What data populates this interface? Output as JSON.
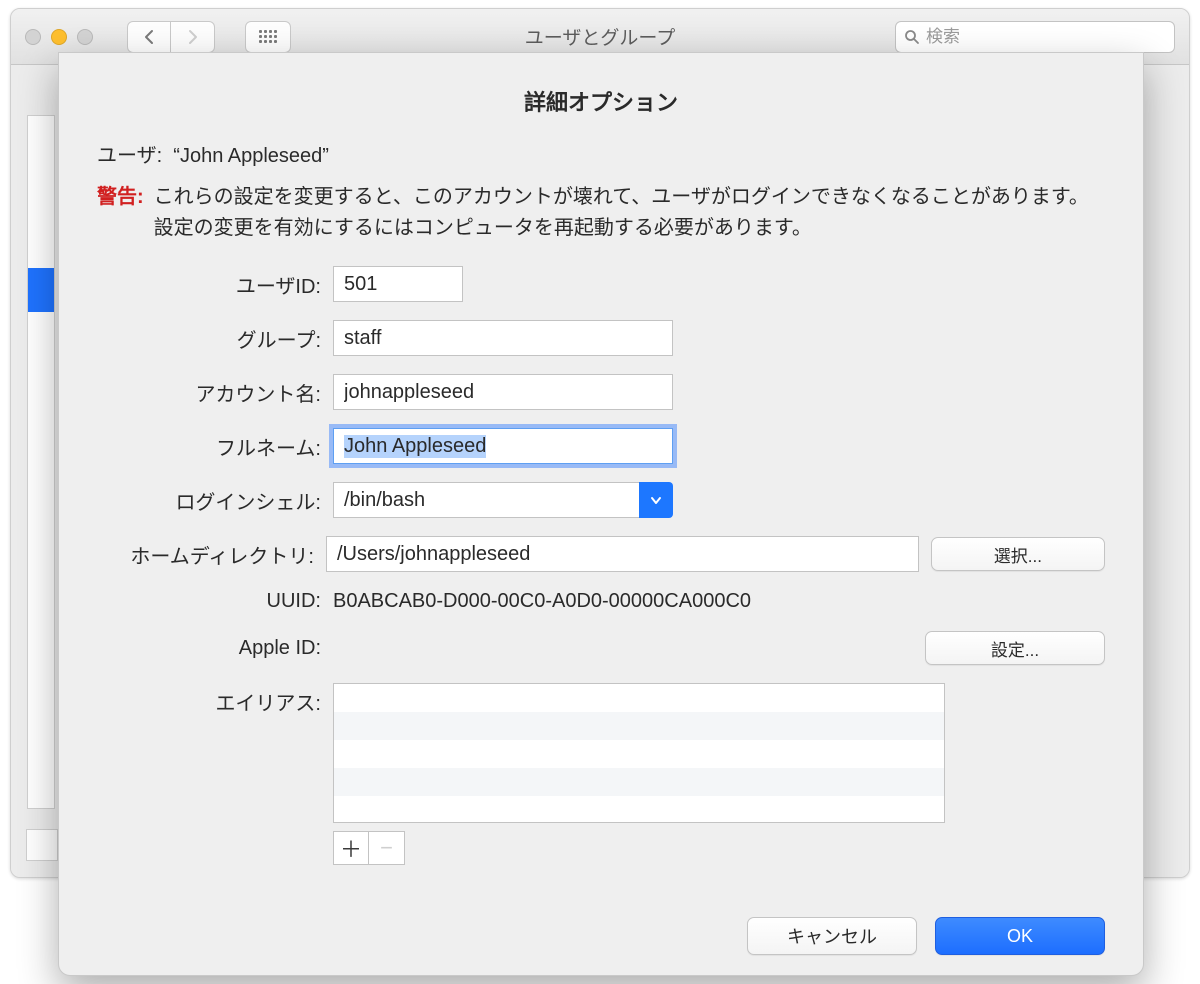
{
  "window": {
    "title": "ユーザとグループ",
    "search_placeholder": "検索"
  },
  "sheet": {
    "title": "詳細オプション",
    "user_prefix": "ユーザ:",
    "user_name_quoted": "“John Appleseed”",
    "warning_label": "警告:",
    "warning_text": "これらの設定を変更すると、このアカウントが壊れて、ユーザがログインできなくなることがあります。設定の変更を有効にするにはコンピュータを再起動する必要があります。",
    "labels": {
      "user_id": "ユーザID:",
      "group": "グループ:",
      "account_name": "アカウント名:",
      "full_name": "フルネーム:",
      "login_shell": "ログインシェル:",
      "home_dir": "ホームディレクトリ:",
      "uuid": "UUID:",
      "apple_id": "Apple ID:",
      "aliases": "エイリアス:"
    },
    "values": {
      "user_id": "501",
      "group": "staff",
      "account_name": "johnappleseed",
      "full_name": "John Appleseed",
      "login_shell": "/bin/bash",
      "home_dir": "/Users/johnappleseed",
      "uuid": "B0ABCAB0-D000-00C0-A0D0-00000CA000C0",
      "apple_id": ""
    },
    "buttons": {
      "choose": "選択...",
      "set": "設定...",
      "cancel": "キャンセル",
      "ok": "OK",
      "add": "＋",
      "remove": "−"
    }
  }
}
